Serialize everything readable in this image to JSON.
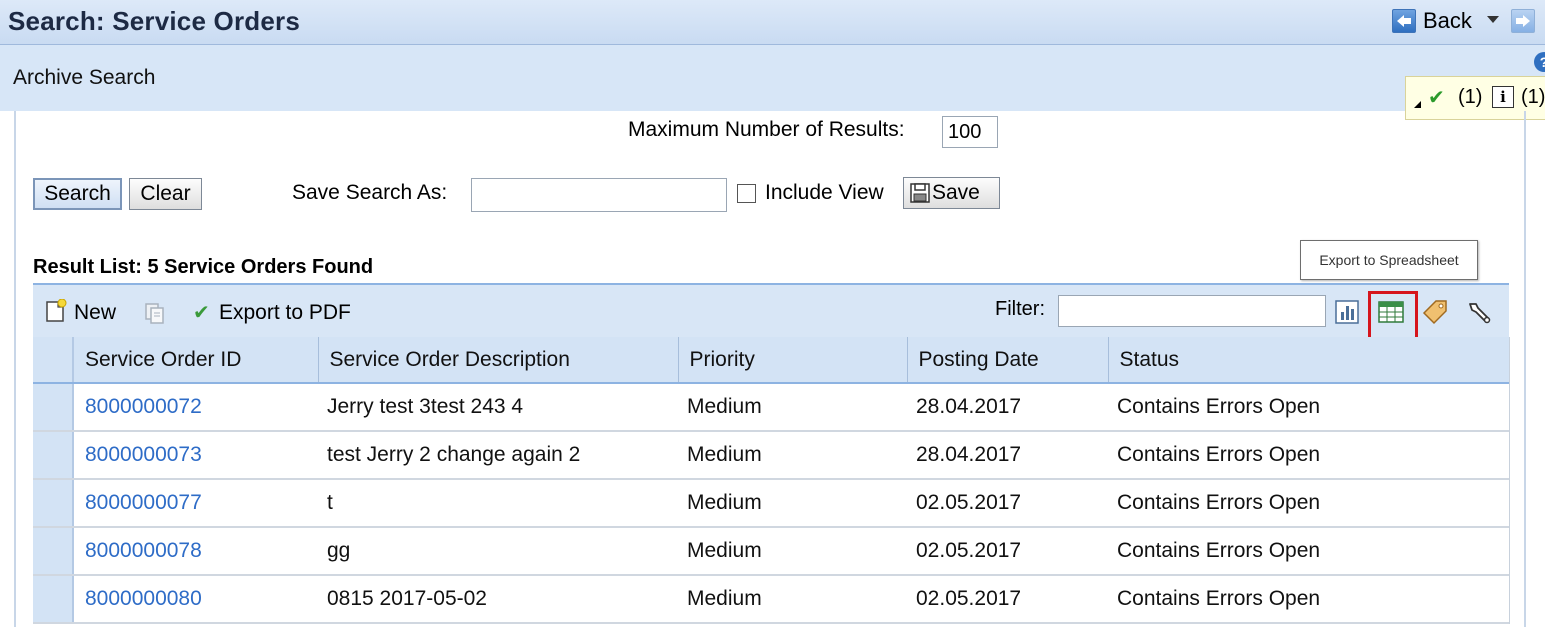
{
  "header": {
    "title": "Search: Service Orders",
    "back_label": "Back",
    "icons": [
      "back-arrow-icon",
      "forward-arrow-icon",
      "dropdown-arrow-icon",
      "help-icon"
    ]
  },
  "subheader": {
    "title": "Archive Search"
  },
  "messages": {
    "success_count": "(1)",
    "info_count": "(1)",
    "info_glyph": "i",
    "help_glyph": "?"
  },
  "search": {
    "max_results_label": "Maximum Number of Results:",
    "max_results_value": "100",
    "search_button": "Search",
    "clear_button": "Clear",
    "save_search_label": "Save Search As:",
    "save_search_value": "",
    "include_view_label": "Include View",
    "save_button": "Save"
  },
  "results": {
    "title": "Result List: 5 Service Orders Found",
    "tooltip": "Export to Spreadsheet",
    "toolbar": {
      "new_label": "New",
      "export_pdf_label": "Export to PDF",
      "filter_label": "Filter:",
      "filter_value": ""
    },
    "columns": [
      "Service Order ID",
      "Service Order Description",
      "Priority",
      "Posting Date",
      "Status"
    ],
    "rows": [
      {
        "id": "8000000072",
        "description": "Jerry test 3test 243 4",
        "priority": "Medium",
        "date": "28.04.2017",
        "status": "Contains Errors Open"
      },
      {
        "id": "8000000073",
        "description": "test Jerry 2 change again 2",
        "priority": "Medium",
        "date": "28.04.2017",
        "status": "Contains Errors Open"
      },
      {
        "id": "8000000077",
        "description": "t",
        "priority": "Medium",
        "date": "02.05.2017",
        "status": "Contains Errors Open"
      },
      {
        "id": "8000000078",
        "description": "gg",
        "priority": "Medium",
        "date": "02.05.2017",
        "status": "Contains Errors Open"
      },
      {
        "id": "8000000080",
        "description": "0815 2017-05-02",
        "priority": "Medium",
        "date": "02.05.2017",
        "status": "Contains Errors Open"
      }
    ]
  },
  "colors": {
    "link": "#2e6cc7",
    "header_bg": "#d7e6f7",
    "highlight": "#d6151d"
  }
}
